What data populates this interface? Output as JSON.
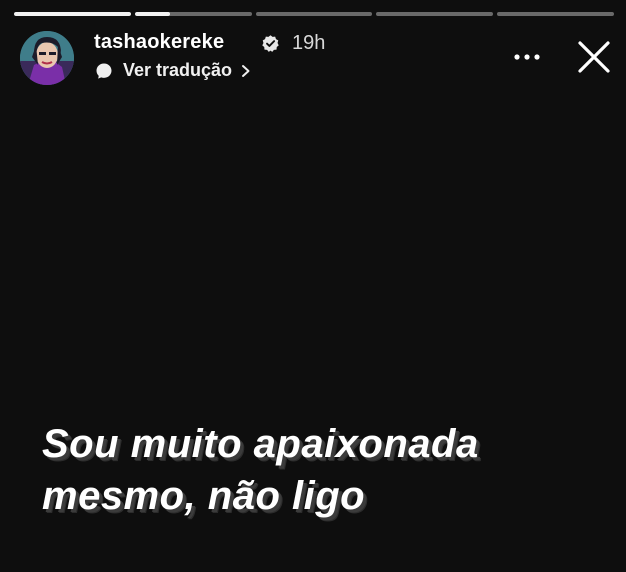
{
  "story": {
    "progress_segments": [
      {
        "fill": 1.0
      },
      {
        "fill": 0.3
      },
      {
        "fill": 0.0
      },
      {
        "fill": 0.0
      },
      {
        "fill": 0.0
      }
    ]
  },
  "header": {
    "username": "tashaokereke",
    "time": "19h",
    "translate_label": "Ver tradução",
    "verified_icon": "verified-badge-icon",
    "more_icon": "more-options-icon",
    "close_icon": "close-icon"
  },
  "caption": {
    "line1": "Sou muito apaixonada",
    "line2": "mesmo, não ligo"
  },
  "colors": {
    "background": "#0e0e0e",
    "text": "#ffffff",
    "progress_active": "#f2f2f2",
    "progress_inactive": "rgba(255,255,255,0.38)"
  }
}
